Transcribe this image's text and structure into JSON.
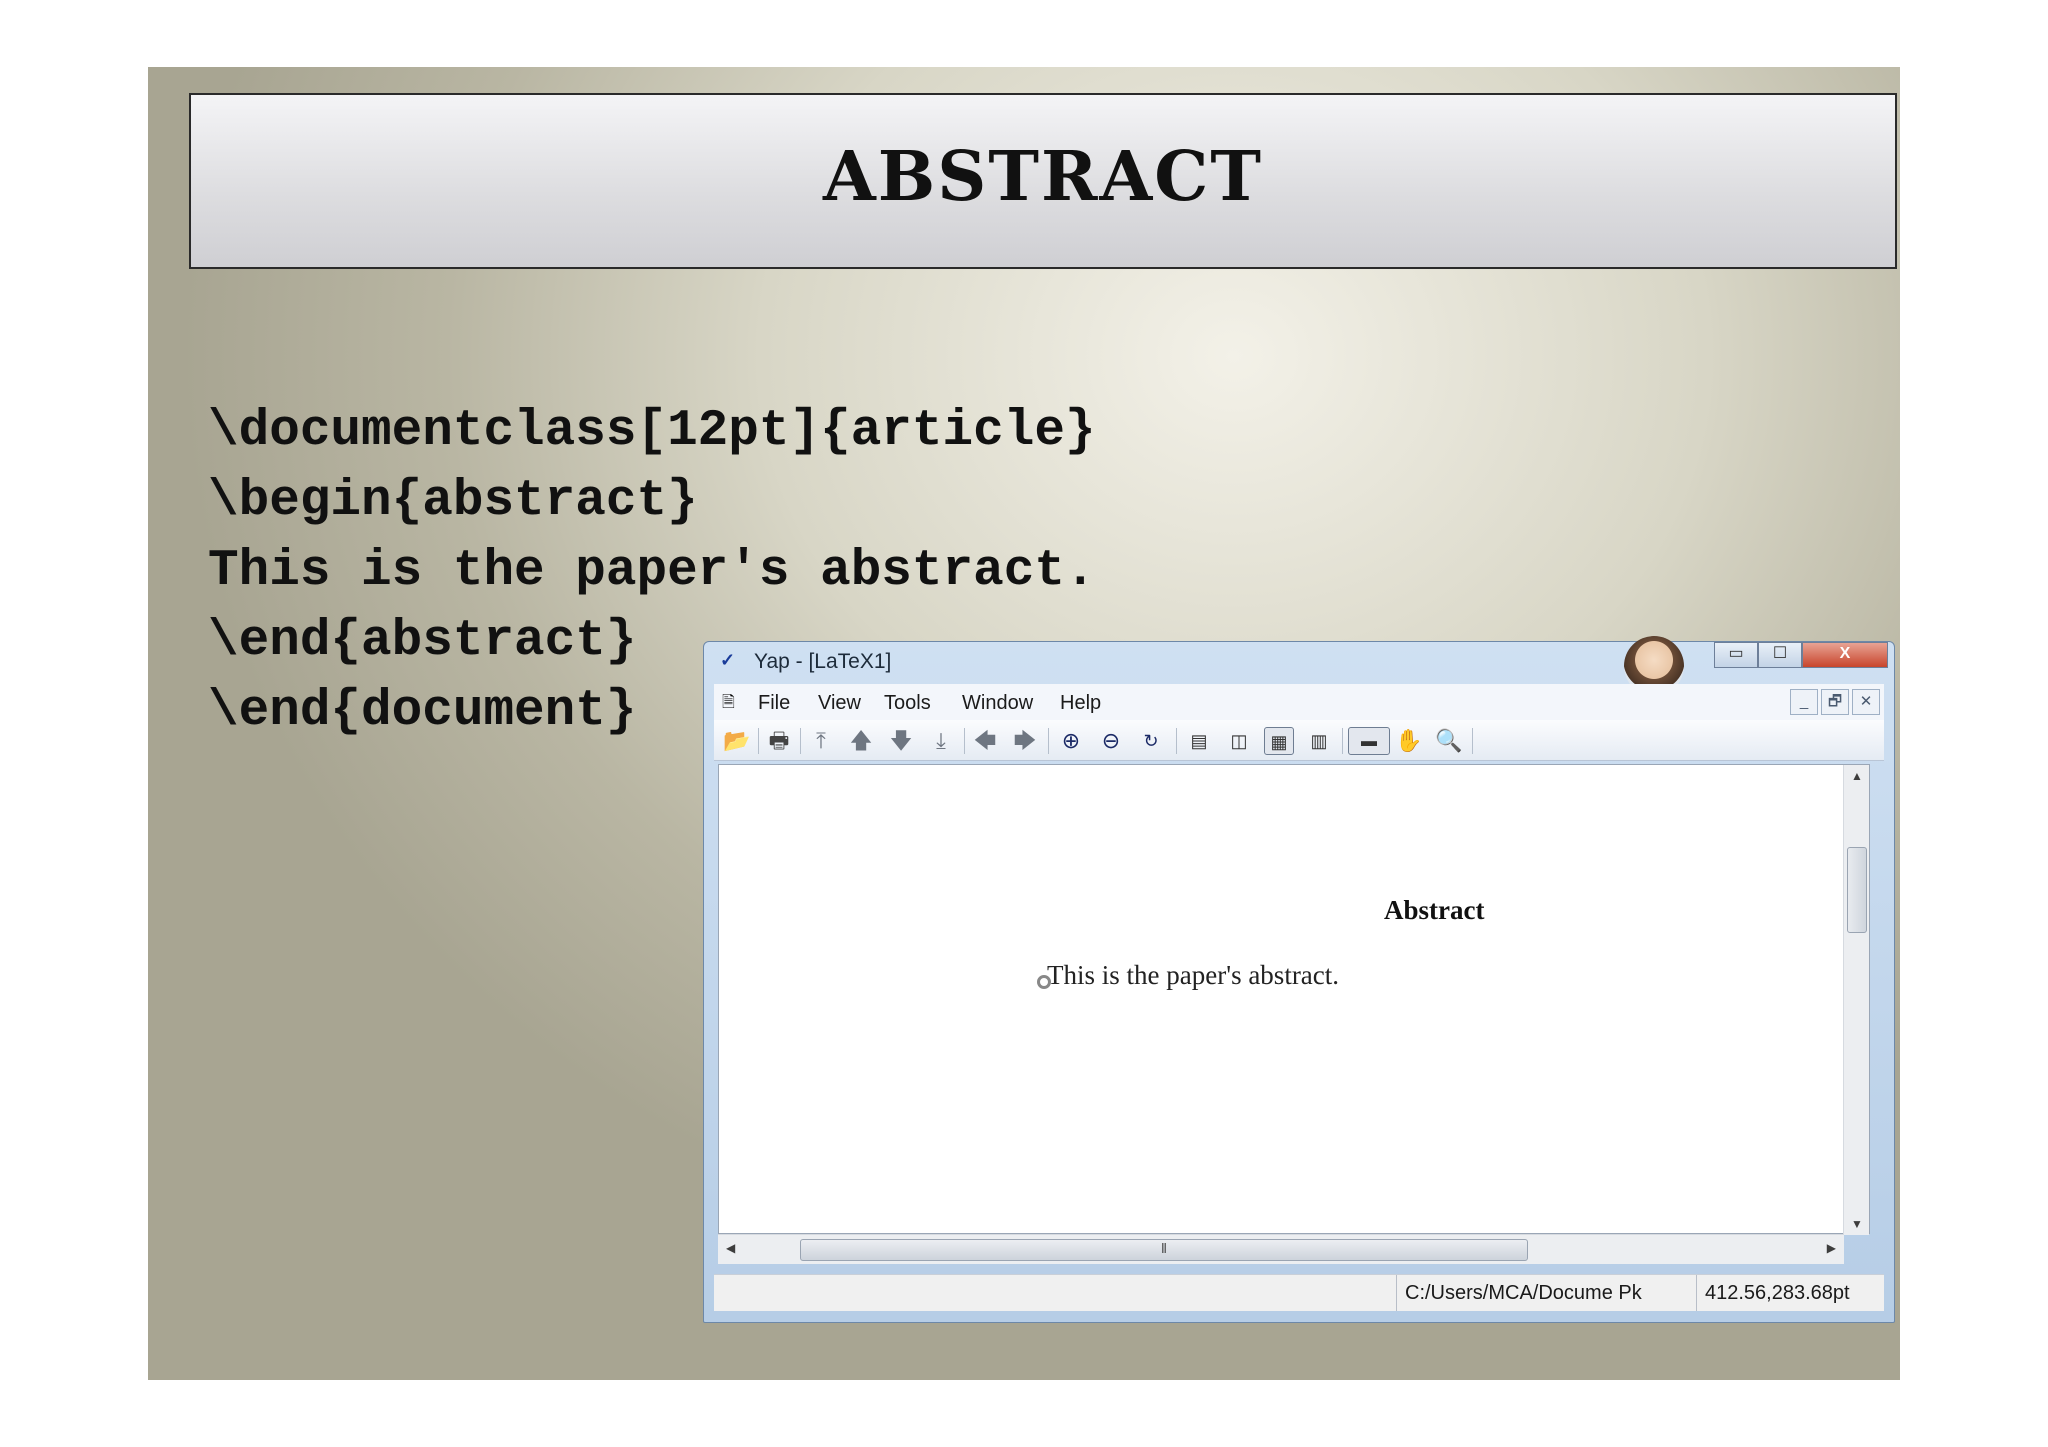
{
  "slide": {
    "title": "ABSTRACT",
    "code_lines": [
      "\\documentclass[12pt]{article}",
      "\\begin{abstract}",
      "This is the paper's abstract.",
      "\\end{abstract}",
      "\\end{document}"
    ]
  },
  "window": {
    "title": "Yap - [LaTeX1]",
    "app_icon": "DVI",
    "controls": {
      "minimize": "▭",
      "maximize": "☐",
      "close": "X"
    },
    "menu": [
      "File",
      "View",
      "Tools",
      "Window",
      "Help"
    ],
    "mdi_controls": [
      "_",
      "🗗",
      "✕"
    ],
    "toolbar_icons": [
      "open-folder-icon",
      "print-icon",
      "first-page-icon",
      "previous-page-icon",
      "next-page-icon",
      "last-page-icon",
      "back-icon",
      "forward-icon",
      "zoom-in-icon",
      "zoom-out-icon",
      "refresh-icon",
      "single-page-icon",
      "double-page-icon",
      "continuous-page-icon",
      "continuous-double-icon",
      "ruler-icon",
      "hand-icon",
      "magnifier-icon"
    ],
    "document": {
      "heading": "Abstract",
      "body": "This is the paper's abstract."
    },
    "status": {
      "path": "C:/Users/MCA/Docume Pk",
      "coords": "412.56,283.68pt"
    }
  }
}
